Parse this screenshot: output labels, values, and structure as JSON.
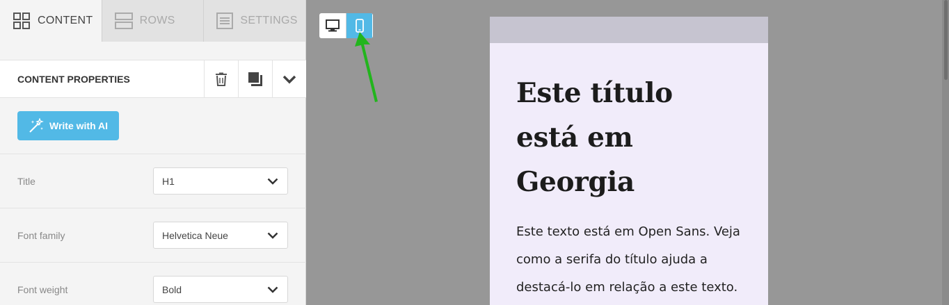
{
  "tabs": [
    {
      "label": "CONTENT",
      "icon": "grid-icon"
    },
    {
      "label": "ROWS",
      "icon": "rows-icon"
    },
    {
      "label": "SETTINGS",
      "icon": "settings-list-icon"
    }
  ],
  "properties": {
    "title": "CONTENT PROPERTIES",
    "icons": [
      "trash-icon",
      "duplicate-icon",
      "chevron-down-icon"
    ]
  },
  "ai_button": {
    "label": "Write with AI",
    "icon": "magic-wand-icon"
  },
  "fields": [
    {
      "label": "Title",
      "value": "H1"
    },
    {
      "label": "Font family",
      "value": "Helvetica Neue"
    },
    {
      "label": "Font weight",
      "value": "Bold"
    }
  ],
  "preview": {
    "title": "Este título está em Georgia",
    "body": "Este texto está em Open Sans. Veja como a serifa do título ajuda a destacá-lo em relação a este texto."
  },
  "colors": {
    "accent": "#52b9e6",
    "arrow": "#22b51d",
    "canvas": "#979797",
    "email_bg": "#f1ecfa"
  }
}
